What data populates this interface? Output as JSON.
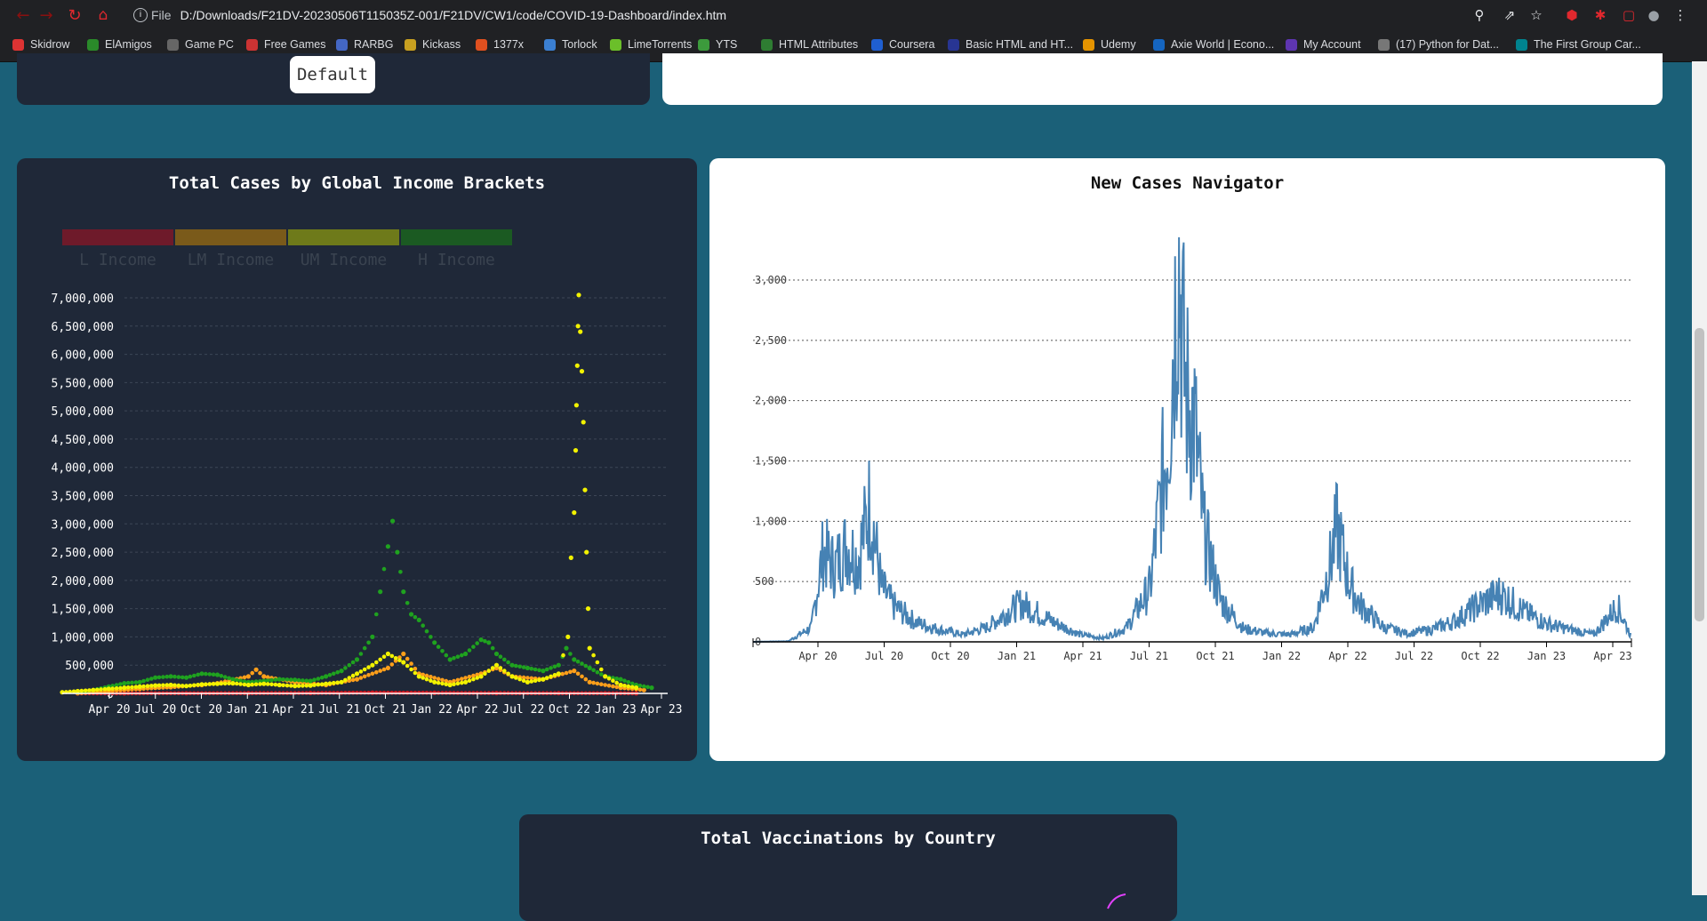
{
  "browser": {
    "file_label": "File",
    "url": "D:/Downloads/F21DV-20230506T115035Z-001/F21DV/CW1/code/COVID-19-Dashboard/index.htm",
    "bookmarks": [
      {
        "label": "Skidrow",
        "color": "#d33"
      },
      {
        "label": "ElAmigos",
        "color": "#2a8a2a"
      },
      {
        "label": "Game PC",
        "color": "#666"
      },
      {
        "label": "Free Games",
        "color": "#c33"
      },
      {
        "label": "RARBG",
        "color": "#4467c4"
      },
      {
        "label": "Kickass",
        "color": "#c8a020"
      },
      {
        "label": "1377x",
        "color": "#e0501f"
      },
      {
        "label": "Torlock",
        "color": "#3b7fd1"
      },
      {
        "label": "LimeTorrents",
        "color": "#6bbf2a"
      },
      {
        "label": "YTS",
        "color": "#3c9a3c"
      },
      {
        "label": "HTML Attributes",
        "color": "#2e7d32"
      },
      {
        "label": "Coursera",
        "color": "#1f5fd1"
      },
      {
        "label": "Basic HTML and HT...",
        "color": "#283593"
      },
      {
        "label": "Udemy",
        "color": "#e59400"
      },
      {
        "label": "Axie World | Econo...",
        "color": "#1565c0"
      },
      {
        "label": "My Account",
        "color": "#5e35b1"
      },
      {
        "label": "(17) Python for Dat...",
        "color": "#777"
      },
      {
        "label": "The First Group Car...",
        "color": "#00838f"
      }
    ]
  },
  "dashboard": {
    "default_button": "Default",
    "income_chart_title": "Total Cases by Global Income Brackets",
    "navigator_title": "New Cases Navigator",
    "vaccinations_title": "Total Vaccinations by Country"
  },
  "chart_data": [
    {
      "type": "scatter",
      "title": "Total Cases by Global Income Brackets",
      "legend_placement": "top-left",
      "legend": [
        {
          "name": "L Income",
          "color": "#6e1a2a"
        },
        {
          "name": "LM Income",
          "color": "#7a5a1a"
        },
        {
          "name": "UM Income",
          "color": "#6e7a1a"
        },
        {
          "name": "H Income",
          "color": "#1b5a22"
        }
      ],
      "x_ticks": [
        "Apr 20",
        "Jul 20",
        "Oct 20",
        "Jan 21",
        "Apr 21",
        "Jul 21",
        "Oct 21",
        "Jan 22",
        "Apr 22",
        "Jul 22",
        "Oct 22",
        "Jan 23",
        "Apr 23"
      ],
      "y_ticks": [
        "0",
        "500,000",
        "1,000,000",
        "1,500,000",
        "2,000,000",
        "2,500,000",
        "3,000,000",
        "3,500,000",
        "4,000,000",
        "4,500,000",
        "5,000,000",
        "5,500,000",
        "6,000,000",
        "6,500,000",
        "7,000,000"
      ],
      "ylim": [
        0,
        7000000
      ],
      "xlim_months": [
        0,
        38
      ],
      "grid": "horizontal dashed",
      "series": [
        {
          "color": "#d4171f",
          "points": [
            [
              1,
              1000
            ],
            [
              4,
              2000
            ],
            [
              8,
              3000
            ],
            [
              12,
              5000
            ],
            [
              16,
              8000
            ],
            [
              20,
              12000
            ],
            [
              24,
              10000
            ],
            [
              28,
              6000
            ],
            [
              32,
              4000
            ],
            [
              35,
              3000
            ],
            [
              37,
              2000
            ]
          ]
        },
        {
          "color": "#ff9f1a",
          "points": [
            [
              1,
              5000
            ],
            [
              3,
              40000
            ],
            [
              5,
              80000
            ],
            [
              7,
              110000
            ],
            [
              9,
              150000
            ],
            [
              10,
              180000
            ],
            [
              12,
              300000
            ],
            [
              12.5,
              420000
            ],
            [
              13,
              300000
            ],
            [
              15,
              200000
            ],
            [
              17,
              150000
            ],
            [
              19,
              250000
            ],
            [
              21,
              450000
            ],
            [
              22,
              700000
            ],
            [
              23,
              350000
            ],
            [
              25,
              200000
            ],
            [
              27,
              350000
            ],
            [
              28,
              450000
            ],
            [
              29,
              300000
            ],
            [
              31,
              250000
            ],
            [
              33,
              400000
            ],
            [
              34,
              200000
            ],
            [
              36,
              100000
            ],
            [
              37.5,
              60000
            ]
          ]
        },
        {
          "color": "#1fa21f",
          "points": [
            [
              1,
              20000
            ],
            [
              2,
              60000
            ],
            [
              3,
              120000
            ],
            [
              4,
              180000
            ],
            [
              5,
              200000
            ],
            [
              6,
              280000
            ],
            [
              7,
              300000
            ],
            [
              8,
              280000
            ],
            [
              9,
              350000
            ],
            [
              10,
              330000
            ],
            [
              11,
              250000
            ],
            [
              12,
              200000
            ],
            [
              13,
              220000
            ],
            [
              14,
              250000
            ],
            [
              15,
              240000
            ],
            [
              16,
              220000
            ],
            [
              17,
              300000
            ],
            [
              18,
              400000
            ],
            [
              19,
              600000
            ],
            [
              20,
              1000000
            ],
            [
              20.5,
              1800000
            ],
            [
              21,
              2600000
            ],
            [
              21.3,
              3050000
            ],
            [
              21.6,
              2500000
            ],
            [
              22,
              1800000
            ],
            [
              22.5,
              1400000
            ],
            [
              23,
              1300000
            ],
            [
              24,
              900000
            ],
            [
              25,
              600000
            ],
            [
              26,
              700000
            ],
            [
              27,
              950000
            ],
            [
              27.5,
              900000
            ],
            [
              28,
              700000
            ],
            [
              29,
              500000
            ],
            [
              30,
              450000
            ],
            [
              31,
              400000
            ],
            [
              32,
              500000
            ],
            [
              32.5,
              800000
            ],
            [
              33,
              600000
            ],
            [
              34,
              450000
            ],
            [
              35,
              300000
            ],
            [
              36,
              250000
            ],
            [
              37,
              150000
            ],
            [
              38,
              100000
            ]
          ]
        },
        {
          "color": "#f2f200",
          "points": [
            [
              0,
              20000
            ],
            [
              1,
              40000
            ],
            [
              2,
              60000
            ],
            [
              3,
              80000
            ],
            [
              4,
              100000
            ],
            [
              5,
              120000
            ],
            [
              6,
              140000
            ],
            [
              7,
              150000
            ],
            [
              8,
              130000
            ],
            [
              9,
              160000
            ],
            [
              10,
              170000
            ],
            [
              11,
              180000
            ],
            [
              12,
              150000
            ],
            [
              13,
              170000
            ],
            [
              14,
              150000
            ],
            [
              15,
              130000
            ],
            [
              16,
              140000
            ],
            [
              17,
              170000
            ],
            [
              18,
              200000
            ],
            [
              19,
              350000
            ],
            [
              20,
              500000
            ],
            [
              21,
              700000
            ],
            [
              22,
              550000
            ],
            [
              23,
              300000
            ],
            [
              24,
              200000
            ],
            [
              25,
              150000
            ],
            [
              26,
              200000
            ],
            [
              27,
              300000
            ],
            [
              28,
              500000
            ],
            [
              29,
              300000
            ],
            [
              30,
              200000
            ],
            [
              31,
              250000
            ],
            [
              32,
              350000
            ],
            [
              32.6,
              1000000
            ],
            [
              32.8,
              2400000
            ],
            [
              33,
              3200000
            ],
            [
              33.1,
              4300000
            ],
            [
              33.15,
              5100000
            ],
            [
              33.2,
              5800000
            ],
            [
              33.25,
              6500000
            ],
            [
              33.3,
              7050000
            ],
            [
              33.4,
              6400000
            ],
            [
              33.5,
              5700000
            ],
            [
              33.6,
              4800000
            ],
            [
              33.7,
              3600000
            ],
            [
              33.8,
              2500000
            ],
            [
              33.9,
              1500000
            ],
            [
              34,
              800000
            ],
            [
              35,
              300000
            ],
            [
              36,
              150000
            ],
            [
              37,
              100000
            ]
          ]
        }
      ]
    },
    {
      "type": "line",
      "title": "New Cases Navigator",
      "color": "#4682b4",
      "x_ticks": [
        "Apr 20",
        "Jul 20",
        "Oct 20",
        "Jan 21",
        "Apr 21",
        "Jul 21",
        "Oct 21",
        "Jan 22",
        "Apr 22",
        "Jul 22",
        "Oct 22",
        "Jan 23",
        "Apr 23"
      ],
      "y_ticks": [
        "0",
        "500",
        "1,000",
        "1,500",
        "2,000",
        "2,500",
        "3,000"
      ],
      "ylim": [
        0,
        3200
      ],
      "xlim_months": [
        0,
        37.6
      ],
      "grid": "horizontal dotted",
      "series_values_monthly": [
        {
          "m": 0,
          "v": 0
        },
        {
          "m": 1.5,
          "v": 5
        },
        {
          "m": 2.5,
          "v": 120
        },
        {
          "m": 3,
          "v": 750
        },
        {
          "m": 3.5,
          "v": 620
        },
        {
          "m": 4,
          "v": 800
        },
        {
          "m": 4.5,
          "v": 680
        },
        {
          "m": 5,
          "v": 1150
        },
        {
          "m": 5.5,
          "v": 450
        },
        {
          "m": 6,
          "v": 300
        },
        {
          "m": 7,
          "v": 160
        },
        {
          "m": 8,
          "v": 100
        },
        {
          "m": 9,
          "v": 60
        },
        {
          "m": 10,
          "v": 120
        },
        {
          "m": 11,
          "v": 260
        },
        {
          "m": 11.5,
          "v": 320
        },
        {
          "m": 12,
          "v": 260
        },
        {
          "m": 13,
          "v": 150
        },
        {
          "m": 14,
          "v": 60
        },
        {
          "m": 15,
          "v": 30
        },
        {
          "m": 16,
          "v": 120
        },
        {
          "m": 17,
          "v": 450
        },
        {
          "m": 17.5,
          "v": 1300
        },
        {
          "m": 17.8,
          "v": 1750
        },
        {
          "m": 18.2,
          "v": 3230
        },
        {
          "m": 18.5,
          "v": 2100
        },
        {
          "m": 18.9,
          "v": 1800
        },
        {
          "m": 19.3,
          "v": 900
        },
        {
          "m": 20,
          "v": 350
        },
        {
          "m": 21,
          "v": 110
        },
        {
          "m": 22,
          "v": 70
        },
        {
          "m": 23,
          "v": 60
        },
        {
          "m": 24,
          "v": 120
        },
        {
          "m": 24.7,
          "v": 650
        },
        {
          "m": 25,
          "v": 950
        },
        {
          "m": 25.5,
          "v": 500
        },
        {
          "m": 26,
          "v": 300
        },
        {
          "m": 27,
          "v": 120
        },
        {
          "m": 28,
          "v": 70
        },
        {
          "m": 29,
          "v": 100
        },
        {
          "m": 30,
          "v": 170
        },
        {
          "m": 31,
          "v": 300
        },
        {
          "m": 32,
          "v": 400
        },
        {
          "m": 33,
          "v": 250
        },
        {
          "m": 34,
          "v": 150
        },
        {
          "m": 35,
          "v": 100
        },
        {
          "m": 36,
          "v": 60
        },
        {
          "m": 37,
          "v": 300
        },
        {
          "m": 37.6,
          "v": 40
        }
      ]
    }
  ]
}
